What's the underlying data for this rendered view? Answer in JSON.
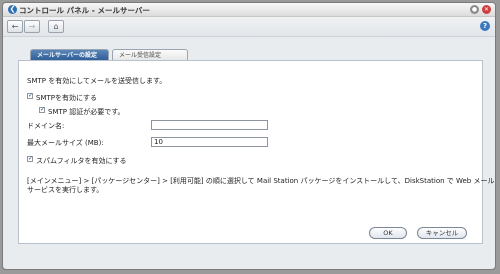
{
  "window": {
    "title": "コントロール パネル - メールサーバー"
  },
  "toolbar": {
    "back_icon": "back-arrow-icon",
    "forward_icon": "forward-arrow-icon",
    "home_icon": "home-icon",
    "help_label": "?"
  },
  "tabs": [
    {
      "label": "メールサーバーの設定",
      "active": true
    },
    {
      "label": "メール受信設定",
      "active": false
    }
  ],
  "form": {
    "intro": "SMTP を有効にしてメールを送受信します。",
    "smtp_enable_label": "SMTPを有効にする",
    "smtp_enable_checked": true,
    "smtp_auth_label": "SMTP 認証が必要です。",
    "smtp_auth_checked": true,
    "domain_label": "ドメイン名:",
    "domain_value": "",
    "max_size_label": "最大メールサイズ (MB):",
    "max_size_value": "10",
    "spam_filter_label": "スパムフィルタを有効にする",
    "spam_filter_checked": true,
    "note_line1": "[メインメニュー] > [パッケージセンター] > [利用可能] の順に選択して Mail Station パッケージをインストールして、DiskStation で Web メール",
    "note_line2": "サービスを実行します。"
  },
  "buttons": {
    "ok": "OK",
    "cancel": "キャンセル"
  }
}
